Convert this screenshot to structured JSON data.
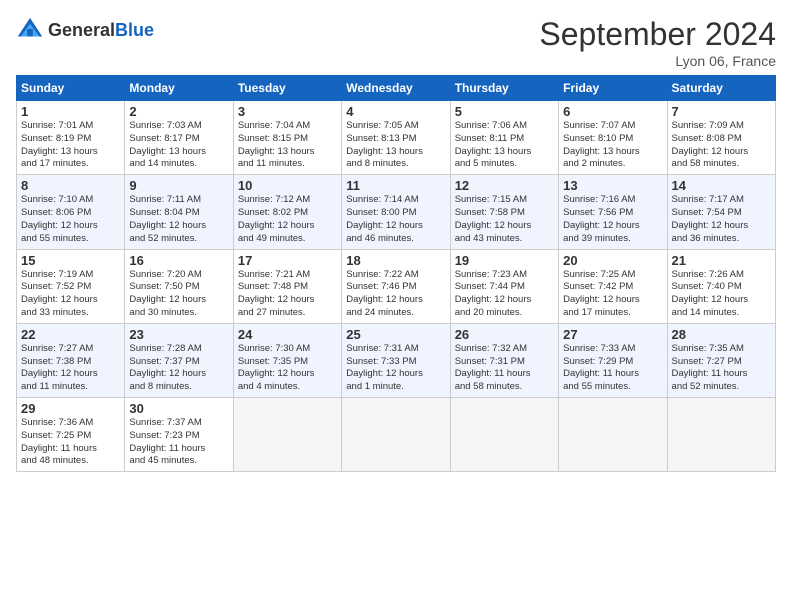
{
  "header": {
    "logo_general": "General",
    "logo_blue": "Blue",
    "title": "September 2024",
    "location": "Lyon 06, France"
  },
  "columns": [
    "Sunday",
    "Monday",
    "Tuesday",
    "Wednesday",
    "Thursday",
    "Friday",
    "Saturday"
  ],
  "weeks": [
    [
      {
        "day": "1",
        "info": "Sunrise: 7:01 AM\nSunset: 8:19 PM\nDaylight: 13 hours\nand 17 minutes."
      },
      {
        "day": "2",
        "info": "Sunrise: 7:03 AM\nSunset: 8:17 PM\nDaylight: 13 hours\nand 14 minutes."
      },
      {
        "day": "3",
        "info": "Sunrise: 7:04 AM\nSunset: 8:15 PM\nDaylight: 13 hours\nand 11 minutes."
      },
      {
        "day": "4",
        "info": "Sunrise: 7:05 AM\nSunset: 8:13 PM\nDaylight: 13 hours\nand 8 minutes."
      },
      {
        "day": "5",
        "info": "Sunrise: 7:06 AM\nSunset: 8:11 PM\nDaylight: 13 hours\nand 5 minutes."
      },
      {
        "day": "6",
        "info": "Sunrise: 7:07 AM\nSunset: 8:10 PM\nDaylight: 13 hours\nand 2 minutes."
      },
      {
        "day": "7",
        "info": "Sunrise: 7:09 AM\nSunset: 8:08 PM\nDaylight: 12 hours\nand 58 minutes."
      }
    ],
    [
      {
        "day": "8",
        "info": "Sunrise: 7:10 AM\nSunset: 8:06 PM\nDaylight: 12 hours\nand 55 minutes."
      },
      {
        "day": "9",
        "info": "Sunrise: 7:11 AM\nSunset: 8:04 PM\nDaylight: 12 hours\nand 52 minutes."
      },
      {
        "day": "10",
        "info": "Sunrise: 7:12 AM\nSunset: 8:02 PM\nDaylight: 12 hours\nand 49 minutes."
      },
      {
        "day": "11",
        "info": "Sunrise: 7:14 AM\nSunset: 8:00 PM\nDaylight: 12 hours\nand 46 minutes."
      },
      {
        "day": "12",
        "info": "Sunrise: 7:15 AM\nSunset: 7:58 PM\nDaylight: 12 hours\nand 43 minutes."
      },
      {
        "day": "13",
        "info": "Sunrise: 7:16 AM\nSunset: 7:56 PM\nDaylight: 12 hours\nand 39 minutes."
      },
      {
        "day": "14",
        "info": "Sunrise: 7:17 AM\nSunset: 7:54 PM\nDaylight: 12 hours\nand 36 minutes."
      }
    ],
    [
      {
        "day": "15",
        "info": "Sunrise: 7:19 AM\nSunset: 7:52 PM\nDaylight: 12 hours\nand 33 minutes."
      },
      {
        "day": "16",
        "info": "Sunrise: 7:20 AM\nSunset: 7:50 PM\nDaylight: 12 hours\nand 30 minutes."
      },
      {
        "day": "17",
        "info": "Sunrise: 7:21 AM\nSunset: 7:48 PM\nDaylight: 12 hours\nand 27 minutes."
      },
      {
        "day": "18",
        "info": "Sunrise: 7:22 AM\nSunset: 7:46 PM\nDaylight: 12 hours\nand 24 minutes."
      },
      {
        "day": "19",
        "info": "Sunrise: 7:23 AM\nSunset: 7:44 PM\nDaylight: 12 hours\nand 20 minutes."
      },
      {
        "day": "20",
        "info": "Sunrise: 7:25 AM\nSunset: 7:42 PM\nDaylight: 12 hours\nand 17 minutes."
      },
      {
        "day": "21",
        "info": "Sunrise: 7:26 AM\nSunset: 7:40 PM\nDaylight: 12 hours\nand 14 minutes."
      }
    ],
    [
      {
        "day": "22",
        "info": "Sunrise: 7:27 AM\nSunset: 7:38 PM\nDaylight: 12 hours\nand 11 minutes."
      },
      {
        "day": "23",
        "info": "Sunrise: 7:28 AM\nSunset: 7:37 PM\nDaylight: 12 hours\nand 8 minutes."
      },
      {
        "day": "24",
        "info": "Sunrise: 7:30 AM\nSunset: 7:35 PM\nDaylight: 12 hours\nand 4 minutes."
      },
      {
        "day": "25",
        "info": "Sunrise: 7:31 AM\nSunset: 7:33 PM\nDaylight: 12 hours\nand 1 minute."
      },
      {
        "day": "26",
        "info": "Sunrise: 7:32 AM\nSunset: 7:31 PM\nDaylight: 11 hours\nand 58 minutes."
      },
      {
        "day": "27",
        "info": "Sunrise: 7:33 AM\nSunset: 7:29 PM\nDaylight: 11 hours\nand 55 minutes."
      },
      {
        "day": "28",
        "info": "Sunrise: 7:35 AM\nSunset: 7:27 PM\nDaylight: 11 hours\nand 52 minutes."
      }
    ],
    [
      {
        "day": "29",
        "info": "Sunrise: 7:36 AM\nSunset: 7:25 PM\nDaylight: 11 hours\nand 48 minutes."
      },
      {
        "day": "30",
        "info": "Sunrise: 7:37 AM\nSunset: 7:23 PM\nDaylight: 11 hours\nand 45 minutes."
      },
      {
        "day": "",
        "info": ""
      },
      {
        "day": "",
        "info": ""
      },
      {
        "day": "",
        "info": ""
      },
      {
        "day": "",
        "info": ""
      },
      {
        "day": "",
        "info": ""
      }
    ]
  ]
}
